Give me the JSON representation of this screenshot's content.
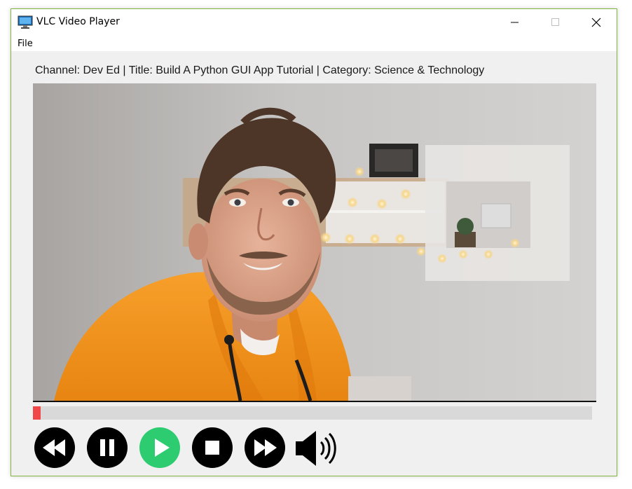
{
  "window": {
    "title": "VLC Video Player"
  },
  "menu": {
    "items": [
      "File"
    ]
  },
  "video_info": {
    "label": "Channel: Dev Ed | Title: Build A Python GUI App Tutorial | Category: Science & Technology"
  },
  "playback": {
    "progress_fraction": 0.014
  },
  "controls": {
    "buttons": [
      {
        "name": "rewind",
        "icon": "rewind-icon",
        "color": "#000000"
      },
      {
        "name": "pause",
        "icon": "pause-icon",
        "color": "#000000"
      },
      {
        "name": "play",
        "icon": "play-icon",
        "color": "#2ecc71"
      },
      {
        "name": "stop",
        "icon": "stop-icon",
        "color": "#000000"
      },
      {
        "name": "fast-forward",
        "icon": "fast-forward-icon",
        "color": "#000000"
      },
      {
        "name": "volume",
        "icon": "volume-icon",
        "color": "#000000"
      }
    ]
  },
  "colors": {
    "progress_fill": "#f04848",
    "progress_track": "#d9d9d9",
    "play_button": "#2ecc71",
    "window_border": "#83b341"
  }
}
